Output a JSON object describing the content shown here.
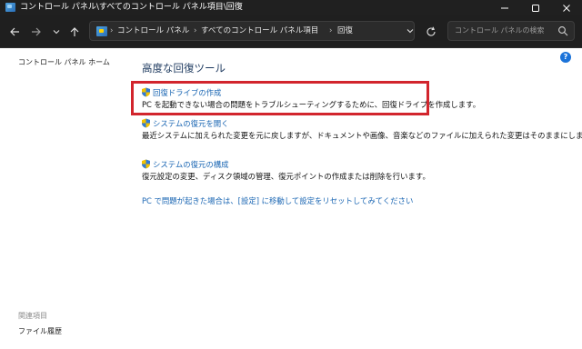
{
  "window": {
    "title": "コントロール パネル\\すべてのコントロール パネル項目\\回復",
    "icon": "control-panel-icon"
  },
  "nav": {
    "back_icon": "arrow-left-icon",
    "forward_icon": "arrow-right-icon",
    "recent_icon": "chevron-down-icon",
    "up_icon": "arrow-up-icon",
    "refresh_icon": "refresh-icon"
  },
  "address": {
    "crumbs": [
      "コントロール パネル",
      "すべてのコントロール パネル項目",
      "回復"
    ],
    "separator": "›"
  },
  "search": {
    "placeholder": "コントロール パネルの検索"
  },
  "sidebar": {
    "home_link": "コントロール パネル ホーム",
    "related_heading": "関連項目",
    "related_items": [
      "ファイル履歴"
    ]
  },
  "main": {
    "title": "高度な回復ツール",
    "items": [
      {
        "label": "回復ドライブの作成",
        "description": "PC を起動できない場合の問題をトラブルシューティングするために、回復ドライブを作成します。"
      },
      {
        "label": "システムの復元を開く",
        "description": "最近システムに加えられた変更を元に戻しますが、ドキュメントや画像、音楽などのファイルに加えられた変更はそのままにします。"
      },
      {
        "label": "システムの復元の構成",
        "description": "復元設定の変更、ディスク領域の管理、復元ポイントの作成または削除を行います。"
      }
    ],
    "reset_link": "PC で問題が起きた場合は、[設定] に移動して設定をリセットしてみてください"
  },
  "colors": {
    "titlebar": "#202020",
    "link": "#1a66b3",
    "highlight": "#d2252d",
    "heading": "#1e3a5f"
  }
}
